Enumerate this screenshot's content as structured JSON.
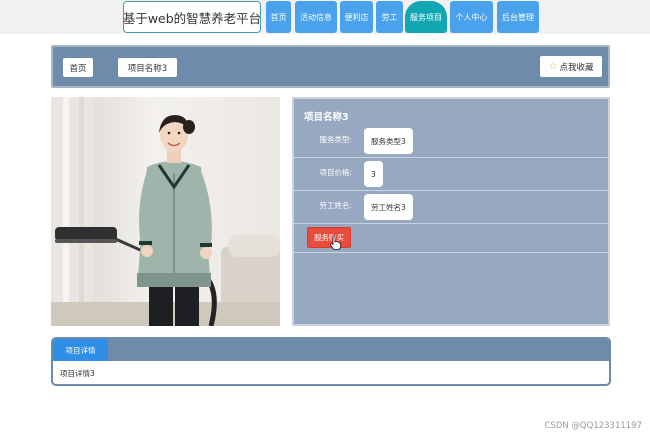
{
  "header": {
    "site_title": "基于web的智慧养老平台",
    "nav": [
      {
        "label": "首页"
      },
      {
        "label": "活动信息"
      },
      {
        "label": "便利店"
      },
      {
        "label": "劳工"
      },
      {
        "label": "服务项目",
        "active": true
      },
      {
        "label": "个人中心"
      },
      {
        "label": "后台管理"
      }
    ]
  },
  "breadcrumb": {
    "home": "首页",
    "current": "项目名称3",
    "favorite_label": "点我收藏"
  },
  "item": {
    "title": "项目名称3",
    "fields": [
      {
        "label": "服务类型:",
        "value": "服务类型3"
      },
      {
        "label": "项目价格:",
        "value": "3"
      },
      {
        "label": "劳工姓名:",
        "value": "劳工姓名3"
      }
    ],
    "buy_label": "服务购买"
  },
  "detail": {
    "tab_label": "项目详情",
    "content": "项目详情3"
  },
  "watermark": "CSDN @QQ123311197",
  "colors": {
    "nav_blue": "#4aa1ec",
    "nav_active": "#12a6b2",
    "panel_slate": "#6e8bab",
    "info_panel": "#97a9c0",
    "buy_red": "#e84c3d"
  }
}
